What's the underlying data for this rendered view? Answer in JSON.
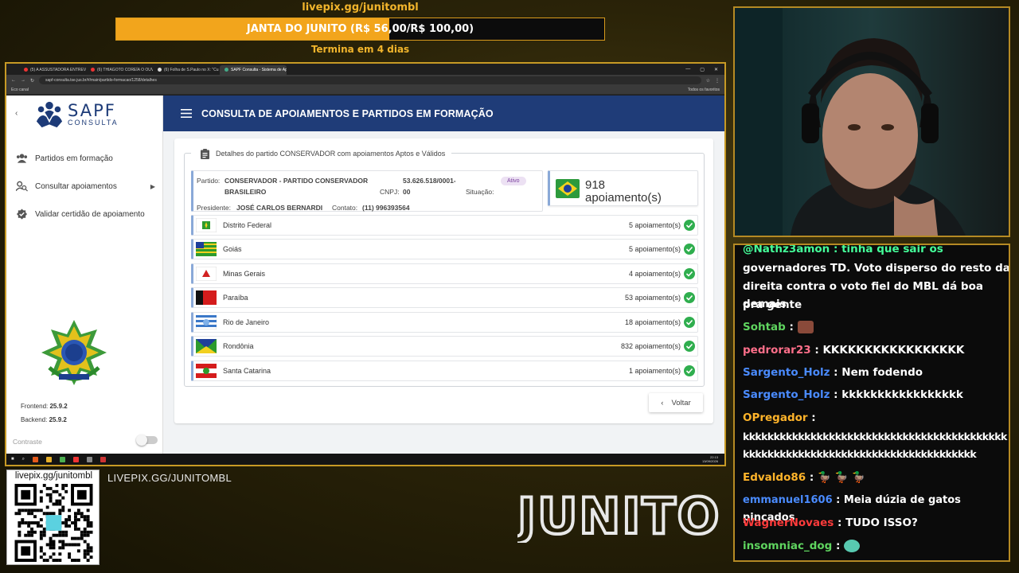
{
  "overlay": {
    "donation_link": "livepix.gg/junitombl",
    "donation_goal_text": "JANTA DO JUNITO (R$ 56,00/R$ 100,00)",
    "donation_progress": 0.56,
    "donation_ends": "Termina em 4 dias",
    "qr_caption": "livepix.gg/junitombl",
    "livepix_url": "LIVEPIX.GG/JUNITOMBL",
    "brand": "JUNITO"
  },
  "browser": {
    "tabs": [
      {
        "label": "(5) A ASSUSTADORA ENTREVI",
        "color": "#e33"
      },
      {
        "label": "(6) THIAGOTO COREÍA O OUVIN",
        "color": "#e33"
      },
      {
        "label": "(6) Folha de S.Paulo no X: \"Cu",
        "color": "#ddd"
      },
      {
        "label": "SAPF Consulta - Sistema de Ap",
        "color": "#4a8"
      }
    ],
    "url": "sapf-consulta.tse.jus.br/#/main/partido-formacao/1258/detalhes",
    "bookmark_label": "Eco canal",
    "all_favorites": "Todos os favoritos"
  },
  "sidebar": {
    "logo_title": "SAPF",
    "logo_sub": "CONSULTA",
    "nav": [
      {
        "label": "Partidos em formação"
      },
      {
        "label": "Consultar apoiamentos"
      },
      {
        "label": "Validar certidão de apoiamento"
      }
    ],
    "frontend_label": "Frontend:",
    "frontend_version": "25.9.2",
    "backend_label": "Backend:",
    "backend_version": "25.9.2",
    "contrast_label": "Contraste"
  },
  "header": {
    "title": "CONSULTA DE APOIAMENTOS E PARTIDOS EM FORMAÇÃO"
  },
  "details": {
    "legend": "Detalhes do partido CONSERVADOR com apoiamentos Aptos e Válidos",
    "party_label": "Partido:",
    "party_name_1": "CONSERVADOR - PARTIDO CONSERVADOR",
    "party_name_2": "BRASILEIRO",
    "cnpj_label": "CNPJ:",
    "cnpj_1": "53.626.518/0001-",
    "cnpj_2": "00",
    "status_label": "Situação:",
    "status": "Ativo",
    "president_label": "Presidente:",
    "president": "JOSÉ CARLOS BERNARDI",
    "contact_label": "Contato:",
    "contact": "(11) 996393564",
    "total_count": "918",
    "total_label": "apoiamento(s)",
    "states": [
      {
        "name": "Distrito Federal",
        "count": "5 apoiamento(s)"
      },
      {
        "name": "Goiás",
        "count": "5 apoiamento(s)"
      },
      {
        "name": "Minas Gerais",
        "count": "4 apoiamento(s)"
      },
      {
        "name": "Paraíba",
        "count": "53 apoiamento(s)"
      },
      {
        "name": "Rio de Janeiro",
        "count": "18 apoiamento(s)"
      },
      {
        "name": "Rondônia",
        "count": "832 apoiamento(s)"
      },
      {
        "name": "Santa Catarina",
        "count": "1 apoiamento(s)"
      }
    ],
    "back_label": "Voltar"
  },
  "taskbar": {
    "clock_time": "22:13",
    "clock_date": "13/09/2026"
  },
  "chat": {
    "messages": [
      {
        "user": "",
        "user_color": "#4f9",
        "text": "@Nathz3amon : tinha que sair os"
      },
      {
        "user": "",
        "user_color": "#fff",
        "text": "governadores TD. Voto disperso do resto da"
      },
      {
        "user": "",
        "user_color": "#fff",
        "text": "direita contra o voto fiel do MBL dá boa demais"
      },
      {
        "user": "",
        "user_color": "#fff",
        "text": "pra gente"
      },
      {
        "user": "Sohtab",
        "user_color": "#5fd45f",
        "text": " :"
      },
      {
        "user": "pedrorar23",
        "user_color": "#ff6f8a",
        "text": " : KKKKKKKKKKKKKKKKK"
      },
      {
        "user": "Sargento_Holz",
        "user_color": "#4a8bff",
        "text": " : Nem fodendo"
      },
      {
        "user": "Sargento_Holz",
        "user_color": "#4a8bff",
        "text": " : kkkkkkkkkkkkkkkkk"
      },
      {
        "user": "OPregador",
        "user_color": "#ffb42a",
        "text": " :"
      },
      {
        "user": "",
        "user_color": "#fff",
        "text": "kkkkkkkkkkkkkkkkkkkkkkkkkkkkkkkkkkkkkkkkkkk"
      },
      {
        "user": "",
        "user_color": "#fff",
        "text": "kkkkkkkkkkkkkkkkkkkkkkkkkkkkkkkkkkkkkk"
      },
      {
        "user": "Edvaldo86",
        "user_color": "#ffb42a",
        "text": " :"
      },
      {
        "user": "emmanuel1606",
        "user_color": "#4a8bff",
        "text": " : Meia dúzia de gatos pincados"
      },
      {
        "user": "WagnerNovaes",
        "user_color": "#ff3b3b",
        "text": " : TUDO ISSO?"
      },
      {
        "user": "insomniac_dog",
        "user_color": "#5fd45f",
        "text": " :"
      }
    ]
  }
}
